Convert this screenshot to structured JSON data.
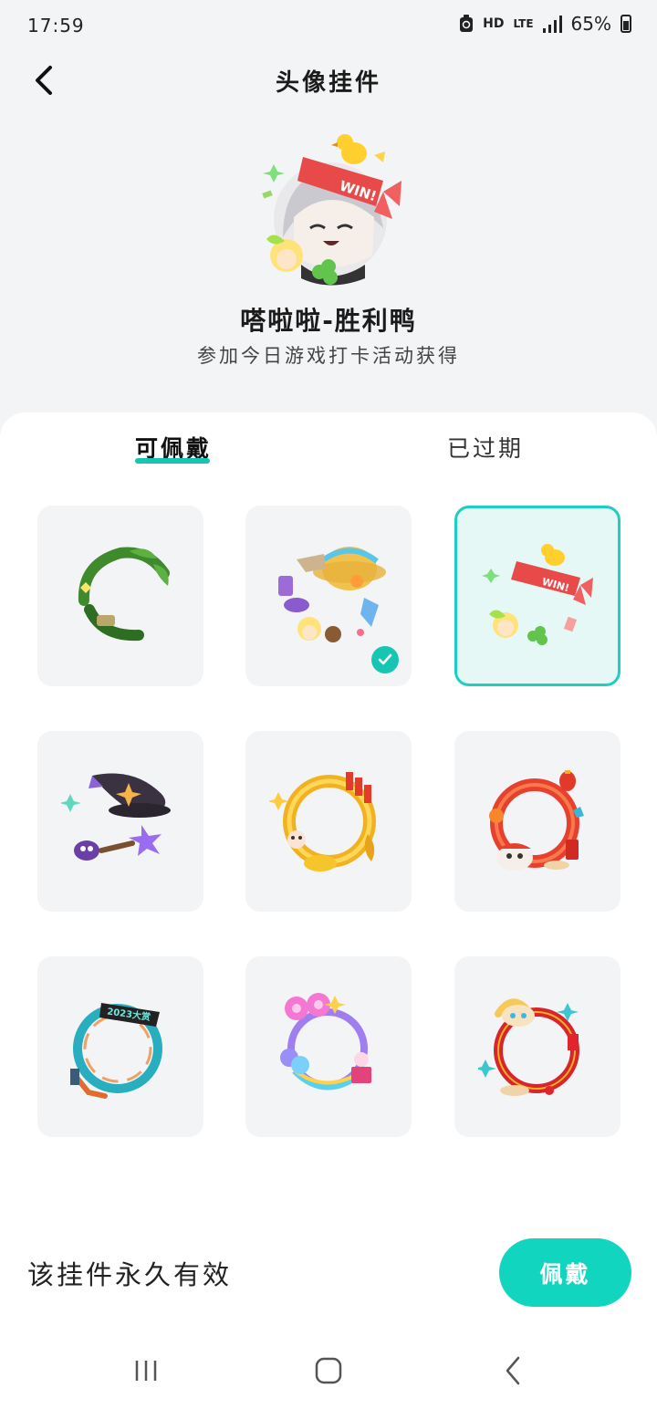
{
  "status": {
    "time": "17:59",
    "hd": "HD",
    "network": "LTE",
    "battery": "65%"
  },
  "header": {
    "title": "头像挂件"
  },
  "preview": {
    "name": "嗒啦啦-胜利鸭",
    "description": "参加今日游戏打卡活动获得",
    "banner_text": "WIN!"
  },
  "tabs": [
    {
      "label": "可佩戴",
      "active": true
    },
    {
      "label": "已过期",
      "active": false
    }
  ],
  "pendants": [
    {
      "icon": "leaf-wreath-pendant-icon",
      "selected": false,
      "wearing": false
    },
    {
      "icon": "straw-hat-pendant-icon",
      "selected": false,
      "wearing": true
    },
    {
      "icon": "win-duck-pendant-icon",
      "selected": true,
      "wearing": false
    },
    {
      "icon": "witch-hat-pendant-icon",
      "selected": false,
      "wearing": false
    },
    {
      "icon": "firecracker-gold-pendant-icon",
      "selected": false,
      "wearing": false
    },
    {
      "icon": "dragon-dance-pendant-icon",
      "selected": false,
      "wearing": false
    },
    {
      "icon": "teal-ring-pendant-icon",
      "selected": false,
      "wearing": false,
      "badge_text": "2023大赏"
    },
    {
      "icon": "balloon-ring-pendant-icon",
      "selected": false,
      "wearing": false
    },
    {
      "icon": "bunny-red-ring-pendant-icon",
      "selected": false,
      "wearing": false
    }
  ],
  "footer": {
    "validity": "该挂件永久有效",
    "wear_button": "佩戴"
  },
  "colors": {
    "accent": "#12d5bf",
    "page_bg": "#f3f4f6",
    "tile_bg": "#f3f4f6",
    "selected_tile_bg": "#e6f8f6"
  }
}
